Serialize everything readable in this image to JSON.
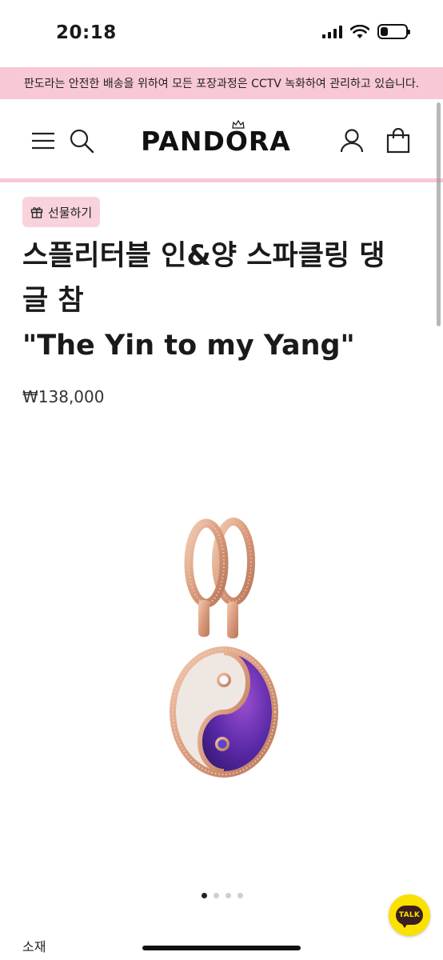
{
  "status_bar": {
    "time": "20:18",
    "battery_level": 0.3,
    "icons": [
      "signal-icon",
      "wifi-icon",
      "battery-icon"
    ]
  },
  "banner": {
    "text": "판도라는 안전한 배송을 위하여 모든 포장과정은 CCTV 녹화하여 관리하고 있습니다.",
    "color": "#f8c8d4"
  },
  "header": {
    "brand": "PANDORA",
    "icons": [
      "menu-icon",
      "search-icon",
      "user-icon",
      "shopping-bag-icon"
    ]
  },
  "product": {
    "gift_label": "선물하기",
    "title_lines": [
      "스플리터블 인&양 스파클링 댕",
      "글 참",
      "\"The Yin to my Yang\""
    ],
    "price": "₩138,000",
    "image": "yin-yang-splittable-charm"
  },
  "carousel": {
    "total": 4,
    "active_index": 0
  },
  "talk_button": {
    "label": "TALK",
    "color": "#fae100"
  },
  "details": {
    "material_label": "소재"
  }
}
